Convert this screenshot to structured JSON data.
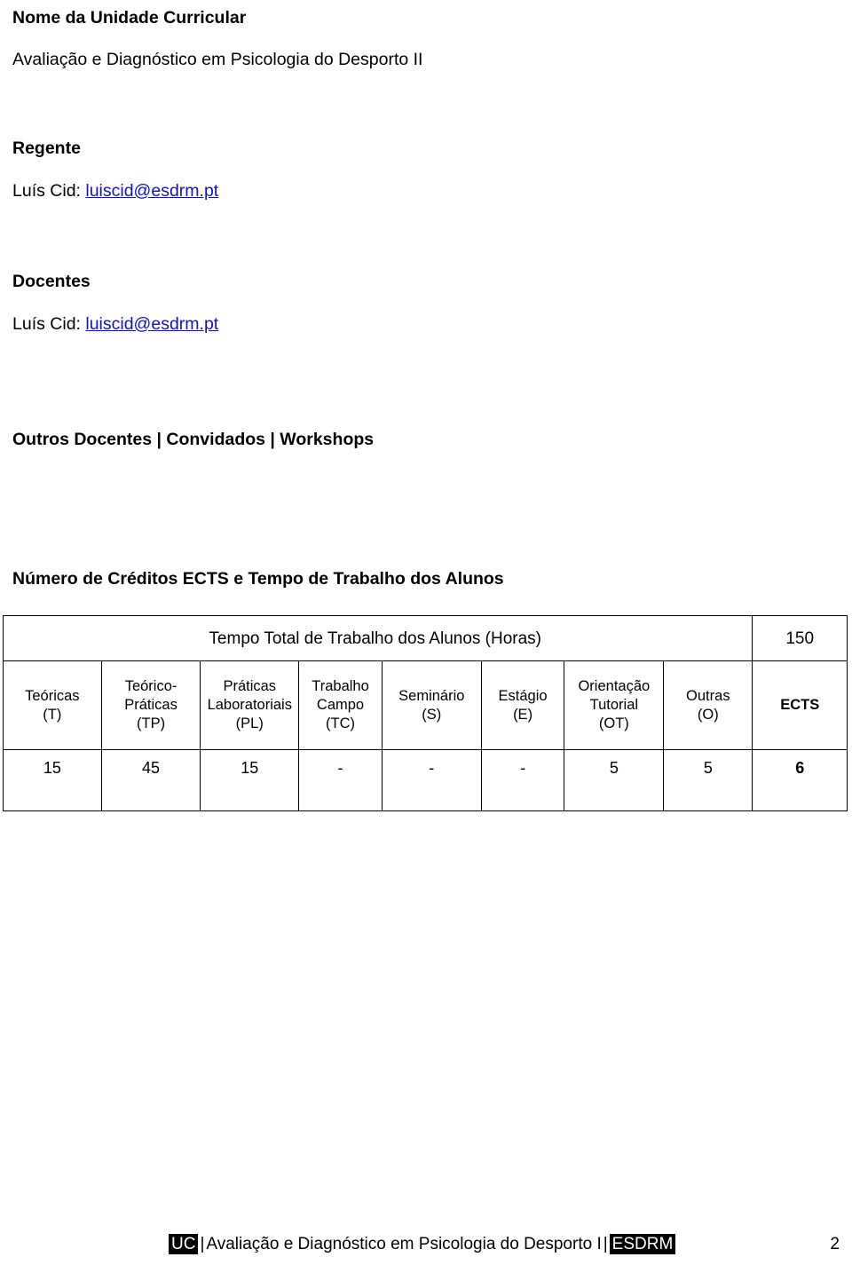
{
  "document": {
    "sections": [
      {
        "heading": "Nome da Unidade Curricular",
        "body": "Avaliação e Diagnóstico em Psicologia do Desporto II"
      },
      {
        "heading": "Regente",
        "body_prefix": "Luís Cid: ",
        "body_link": "luiscid@esdrm.pt"
      },
      {
        "heading": "Docentes",
        "body_prefix": "Luís Cid: ",
        "body_link": "luiscid@esdrm.pt"
      },
      {
        "heading": "Outros Docentes | Convidados | Workshops",
        "body": ""
      },
      {
        "heading": "Número de Créditos ECTS e Tempo de Trabalho dos Alunos",
        "body": ""
      }
    ]
  },
  "table": {
    "total_label": "Tempo Total de Trabalho dos Alunos (Horas)",
    "total_value": "150",
    "headers": [
      {
        "name": "Teóricas",
        "code": "(T)"
      },
      {
        "name": "Teórico-",
        "name2": "Práticas",
        "code": "(TP)"
      },
      {
        "name": "Práticas",
        "name2": "Laboratoriais",
        "code": "(PL)"
      },
      {
        "name": "Trabalho",
        "name2": "Campo",
        "code": "(TC)"
      },
      {
        "name": "Seminário",
        "code": "(S)"
      },
      {
        "name": "Estágio",
        "code": "(E)"
      },
      {
        "name": "Orientação",
        "name2": "Tutorial",
        "code": "(OT)"
      },
      {
        "name": "Outras",
        "code": "(O)"
      },
      {
        "name": "ECTS",
        "code": ""
      }
    ],
    "values": [
      "15",
      "45",
      "15",
      "-",
      "-",
      "-",
      "5",
      "5",
      "6"
    ]
  },
  "footer": {
    "tag_uc": "UC",
    "sep1": "|",
    "title": "Avaliação e Diagnóstico em Psicologia do Desporto I",
    "sep2": "|",
    "tag_school": "ESDRM",
    "page_number": "2"
  }
}
